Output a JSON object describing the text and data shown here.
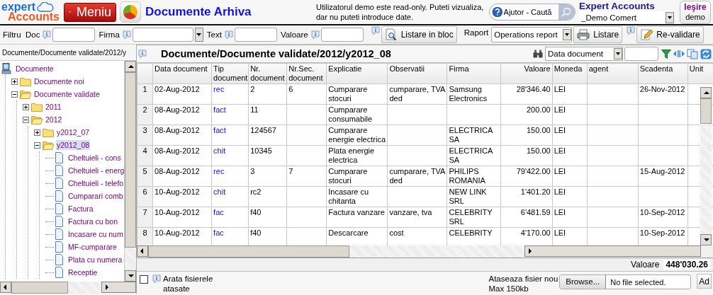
{
  "header": {
    "logo": {
      "line1": "expert",
      "line2": "Accounts"
    },
    "menu_button": "Meniu",
    "page_title": "Documente Arhiva",
    "notice": "Utilizatorul demo este read-only. Puteti vizualiza, dar nu puteti introduce date.",
    "help_search": {
      "placeholder": "Ajutor - Caută"
    },
    "company": {
      "title": "Expert Accounts",
      "value": "_Demo Comert"
    },
    "exit_button": {
      "line1": "Ieşire",
      "line2": "demo"
    }
  },
  "filters": [
    {
      "label": "Filtru  Doc",
      "kind": "text"
    },
    {
      "label": "Firma",
      "kind": "combo"
    },
    {
      "label": "Text",
      "kind": "text"
    },
    {
      "label": "Valoare",
      "kind": "text"
    }
  ],
  "actions": {
    "block_list_button": "Listare in bloc",
    "report_label": "Raport",
    "report_value": "Operations report",
    "list_button": "Listare",
    "revalidate_button": "Re-validare"
  },
  "breadcrumb": "Documente/Documente validate/2012/y",
  "tree": [
    {
      "label": "Documente",
      "kind": "computer",
      "selected": false,
      "children": [
        {
          "label": "Documente noi",
          "kind": "folder",
          "expanded": false,
          "selected": false
        },
        {
          "label": "Documente validate",
          "kind": "folder",
          "expanded": true,
          "selected": false,
          "children": [
            {
              "label": "2011",
              "kind": "folder",
              "expanded": false,
              "selected": false
            },
            {
              "label": "2012",
              "kind": "folder",
              "expanded": true,
              "selected": false,
              "children": [
                {
                  "label": "y2012_07",
                  "kind": "folder",
                  "expanded": false,
                  "selected": false
                },
                {
                  "label": "y2012_08",
                  "kind": "folder",
                  "expanded": true,
                  "selected": true,
                  "children": [
                    {
                      "label": "Cheltuieli - cons",
                      "kind": "document",
                      "selected": false
                    },
                    {
                      "label": "Cheltuieli - energ",
                      "kind": "document",
                      "selected": false
                    },
                    {
                      "label": "Cheltuieli - telefo",
                      "kind": "document",
                      "selected": false
                    },
                    {
                      "label": "Cumparari comb",
                      "kind": "document",
                      "selected": false
                    },
                    {
                      "label": "Factura",
                      "kind": "document",
                      "selected": false
                    },
                    {
                      "label": "Factura cu bon",
                      "kind": "document",
                      "selected": false
                    },
                    {
                      "label": "Incasare cu num",
                      "kind": "document",
                      "selected": false
                    },
                    {
                      "label": "MF-cumparare",
                      "kind": "document",
                      "selected": false
                    },
                    {
                      "label": "Plata cu numera",
                      "kind": "document",
                      "selected": false
                    },
                    {
                      "label": "Receptie",
                      "kind": "document",
                      "selected": false
                    }
                  ]
                }
              ]
            }
          ]
        }
      ]
    }
  ],
  "grid": {
    "title": "Documente/Documente validate/2012/y2012_08",
    "sort_field": "Data document",
    "columns": [
      {
        "kind": "index"
      },
      {
        "label": "Data document",
        "kind": "text"
      },
      {
        "label": "Tip document",
        "kind": "link"
      },
      {
        "label": "Nr. document",
        "kind": "text"
      },
      {
        "label": "Nr.Sec. document",
        "kind": "text"
      },
      {
        "label": "Explicatie",
        "kind": "text"
      },
      {
        "label": "Observatii",
        "kind": "text"
      },
      {
        "label": "Firma",
        "kind": "text"
      },
      {
        "label": "Valoare",
        "kind": "number"
      },
      {
        "label": "Moneda",
        "kind": "text"
      },
      {
        "label": "agent",
        "kind": "text"
      },
      {
        "label": "Scadenta",
        "kind": "text"
      },
      {
        "label": "Unit",
        "kind": "text"
      }
    ],
    "rows": [
      [
        "1",
        "02-Aug-2012",
        "rec",
        "2",
        "6",
        "Cumparare stocuri",
        "cumparare, TVA ded",
        "Samsung Electronics",
        "28'346.40",
        "LEI",
        "",
        "26-Nov-2012",
        ""
      ],
      [
        "2",
        "08-Aug-2012",
        "fact",
        "11",
        "",
        "Cumparare consumabile",
        "",
        "",
        "200.00",
        "LEI",
        "",
        "",
        ""
      ],
      [
        "3",
        "08-Aug-2012",
        "fact",
        "124567",
        "",
        "Cumparare energie electrica",
        "",
        "ELECTRICA SA",
        "150.00",
        "LEI",
        "",
        "",
        ""
      ],
      [
        "4",
        "08-Aug-2012",
        "chit",
        "10345",
        "",
        "Plata energie electrica",
        "",
        "ELECTRICA SA",
        "150.00",
        "LEI",
        "",
        "",
        ""
      ],
      [
        "5",
        "08-Aug-2012",
        "rec",
        "3",
        "7",
        "Cumparare stocuri",
        "cumparare, TVA ded",
        "PHILIPS ROMANIA",
        "79'422.00",
        "LEI",
        "",
        "15-Aug-2012",
        ""
      ],
      [
        "6",
        "10-Aug-2012",
        "chit",
        "rc2",
        "",
        "Incasare cu chitanta",
        "",
        "NEW LINK SRL",
        "1'401.20",
        "LEI",
        "",
        "",
        ""
      ],
      [
        "7",
        "10-Aug-2012",
        "fac",
        "f40",
        "",
        "Factura vanzare",
        "vanzare, tva",
        "CELEBRITY SRL",
        "6'481.59",
        "LEI",
        "",
        "10-Sep-2012",
        ""
      ],
      [
        "8",
        "10-Aug-2012",
        "fac",
        "f40",
        "",
        "Descarcare",
        "cost",
        "CELEBRITY",
        "4'170.00",
        "LEI",
        "",
        "10-Sep-2012",
        ""
      ]
    ],
    "total": {
      "label": "Valoare",
      "value": "448'030.26"
    }
  },
  "attachments": {
    "show_files": {
      "label": "Arata fisierele atasate",
      "checked": false
    },
    "attach_label": "Ataseaza fisier nou",
    "size_note": "Max 150kb",
    "browse_button": "Browse...",
    "file_status": "No file selected.",
    "add_button": "Ad"
  }
}
